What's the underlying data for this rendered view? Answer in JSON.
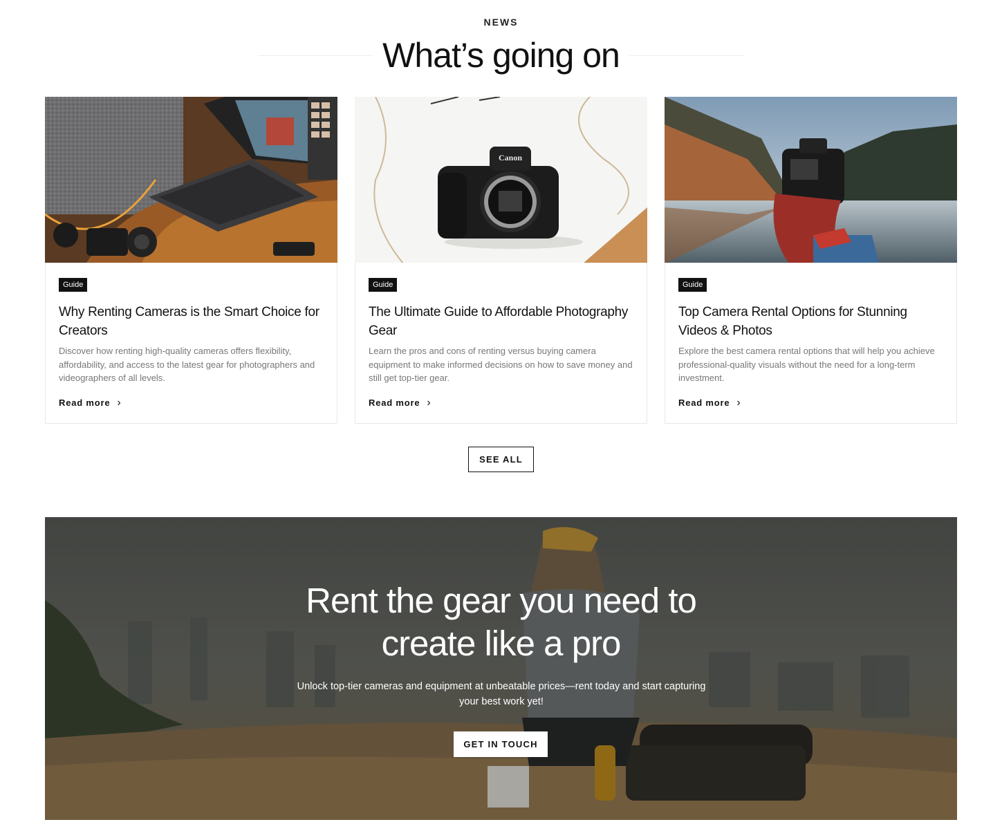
{
  "section": {
    "eyebrow": "NEWS",
    "title": "What’s going on"
  },
  "cards": [
    {
      "tag": "Guide",
      "title": "Why Renting Cameras is the Smart Choice for Creators",
      "description": "Discover how renting high-quality cameras offers flexibility, affordability, and access to the latest gear for photographers and videographers of all levels.",
      "read_more": "Read more"
    },
    {
      "tag": "Guide",
      "title": "The Ultimate Guide to Affordable Photography Gear",
      "description": "Learn the pros and cons of renting versus buying camera equipment to make informed decisions on how to save money and still get top-tier gear.",
      "read_more": "Read more"
    },
    {
      "tag": "Guide",
      "title": "Top Camera Rental Options for Stunning Videos & Photos",
      "description": "Explore the best camera rental options that will help you achieve professional-quality visuals without the need for a long-term investment.",
      "read_more": "Read more"
    }
  ],
  "see_all_label": "SEE ALL",
  "cta": {
    "title_line1": "Rent the gear you need to",
    "title_line2": "create like a pro",
    "subtitle": "Unlock top-tier cameras and equipment at unbeatable prices—rent today and start capturing your best work yet!",
    "button_label": "GET IN TOUCH"
  },
  "image_labels": {
    "camera_brand": "Canon"
  },
  "icons": {
    "read_more_icon": "chevron-right-icon"
  }
}
